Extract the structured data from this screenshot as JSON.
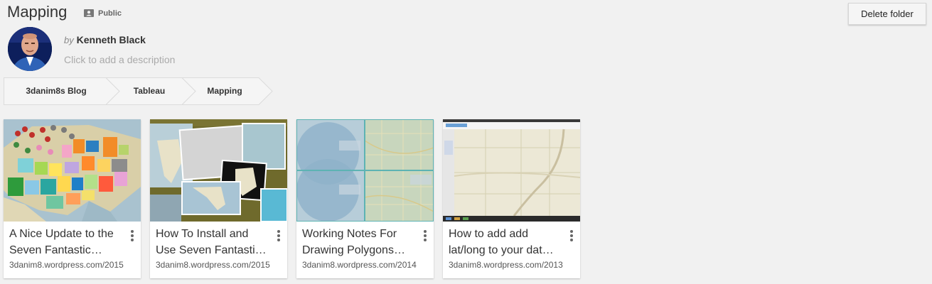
{
  "folder": {
    "title": "Mapping",
    "visibility_label": "Public",
    "delete_label": "Delete folder",
    "by_label": "by",
    "author": "Kenneth Black",
    "description_placeholder": "Click to add a description"
  },
  "breadcrumbs": [
    "3danim8s Blog",
    "Tableau",
    "Mapping"
  ],
  "cards": [
    {
      "title_line1": "A Nice Update to the",
      "title_line2": "Seven Fantastic…",
      "source": "3danim8.wordpress.com/2015"
    },
    {
      "title_line1": "How To Install and",
      "title_line2": "Use Seven Fantasti…",
      "source": "3danim8.wordpress.com/2015"
    },
    {
      "title_line1": "Working Notes For",
      "title_line2": "Drawing Polygons…",
      "source": "3danim8.wordpress.com/2014"
    },
    {
      "title_line1": "How to add add",
      "title_line2": "lat/long to your dat…",
      "source": "3danim8.wordpress.com/2013"
    }
  ]
}
